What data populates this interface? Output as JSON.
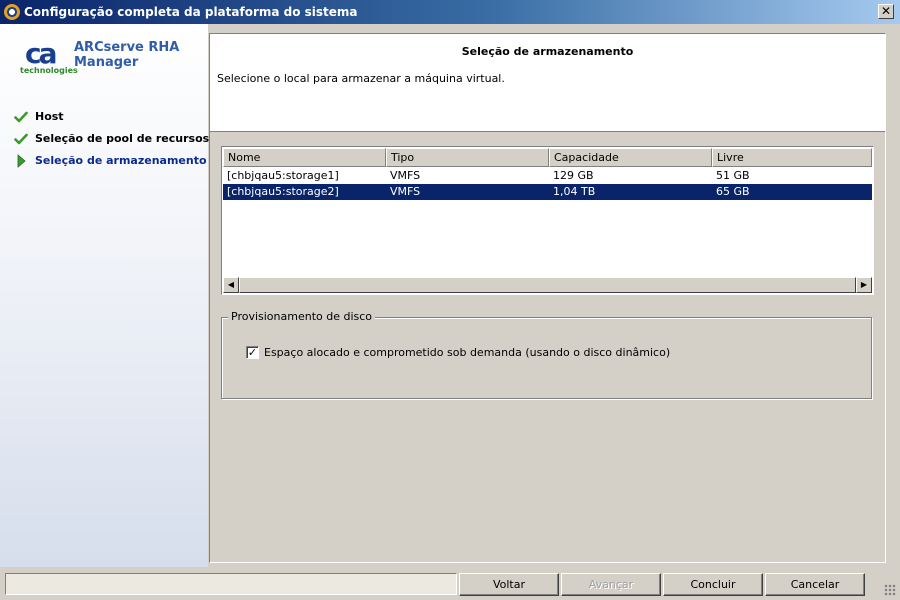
{
  "window": {
    "title": "Configuração completa da plataforma do sistema",
    "close_glyph": "✕"
  },
  "sidebar": {
    "logo": {
      "mark": "ca",
      "sub": "technologies",
      "mark_color": "#1b3f8f",
      "sub_color": "#2d8a2d"
    },
    "product_name": "ARCserve RHA Manager",
    "steps": [
      {
        "label": "Host",
        "icon": "checkmark-icon",
        "state": "done"
      },
      {
        "label": "Seleção de pool de recursos",
        "icon": "checkmark-icon",
        "state": "done"
      },
      {
        "label": "Seleção de armazenamento",
        "icon": "arrow-right-icon",
        "state": "active"
      }
    ]
  },
  "main": {
    "title": "Seleção de armazenamento",
    "description": "Selecione o local para armazenar a máquina virtual.",
    "table": {
      "columns": [
        "Nome",
        "Tipo",
        "Capacidade",
        "Livre"
      ],
      "rows": [
        {
          "name": "[chbjqau5:storage1]",
          "type": "VMFS",
          "capacity": "129 GB",
          "free": "51 GB",
          "selected": false
        },
        {
          "name": "[chbjqau5:storage2]",
          "type": "VMFS",
          "capacity": "1,04 TB",
          "free": "65 GB",
          "selected": true
        }
      ]
    },
    "provisioning": {
      "legend": "Provisionamento de disco",
      "checkbox_label": "Espaço alocado e comprometido sob demanda (usando o disco dinâmico)",
      "checked": true
    }
  },
  "buttons": {
    "back": "Voltar",
    "next": "Avançar",
    "finish": "Concluir",
    "cancel": "Cancelar"
  },
  "colors": {
    "selection": "#0a246a",
    "check_green": "#3a9a2a",
    "active_step": "#0b2a8c"
  }
}
